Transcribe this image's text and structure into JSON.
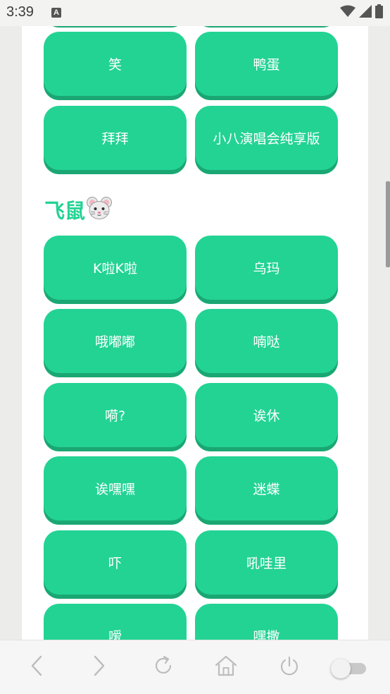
{
  "status_bar": {
    "time": "3:39",
    "notification_icon": "A"
  },
  "top_row": [
    {
      "label": ""
    },
    {
      "label": ""
    }
  ],
  "rows_section_1": [
    {
      "left": "笑",
      "right": "鸭蛋"
    },
    {
      "left": "拜拜",
      "right": "小八演唱会纯享版"
    }
  ],
  "section": {
    "title": "飞鼠",
    "emoji": "🐭"
  },
  "rows_section_2": [
    {
      "left": "K啦K啦",
      "right": "乌玛"
    },
    {
      "left": "哦嘟嘟",
      "right": "喃哒"
    },
    {
      "left": "嗬?",
      "right": "诶休"
    },
    {
      "left": "诶嘿嘿",
      "right": "迷蝶"
    },
    {
      "left": "吓",
      "right": "吼哇里"
    },
    {
      "left": "嗳",
      "right": "嘿撒"
    }
  ],
  "colors": {
    "button": "#23d394",
    "button_shadow": "#1aa773",
    "title": "#23d394"
  },
  "bottom_nav": {
    "icons": [
      "back-icon",
      "forward-icon",
      "refresh-icon",
      "home-icon",
      "power-icon",
      "toggle-switch"
    ]
  }
}
